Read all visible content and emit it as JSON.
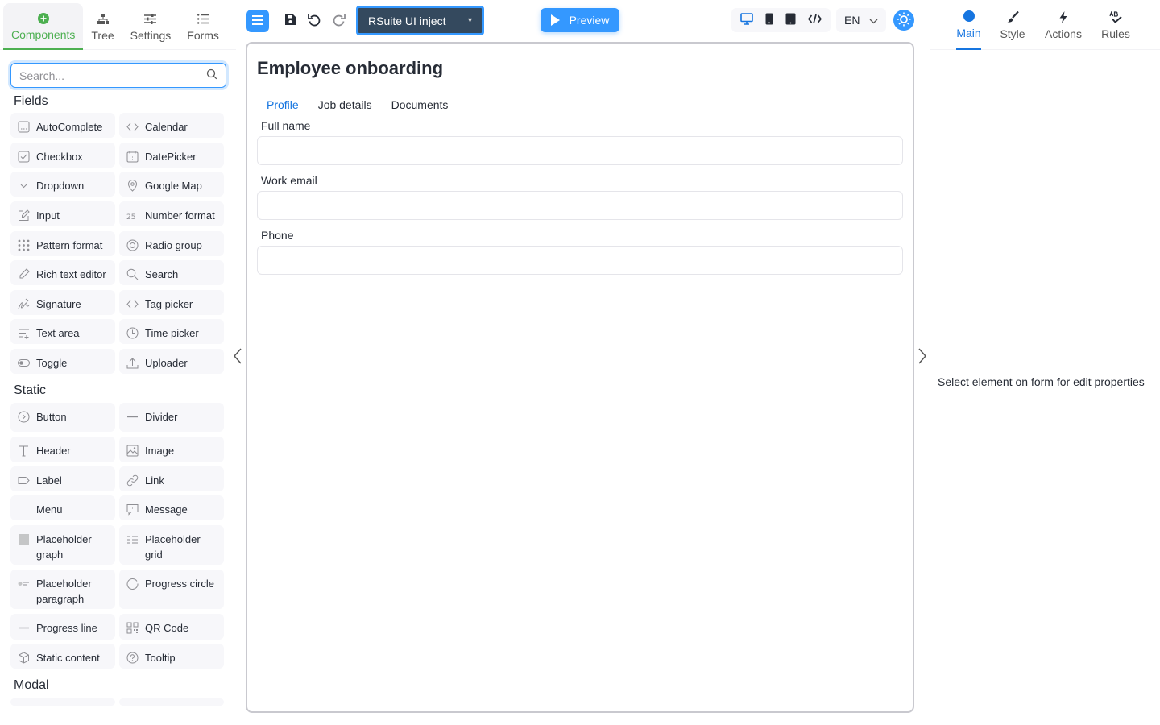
{
  "left_tabs": [
    {
      "label": "Components",
      "icon": "plus-circle-icon"
    },
    {
      "label": "Tree",
      "icon": "tree-icon"
    },
    {
      "label": "Settings",
      "icon": "sliders-icon"
    },
    {
      "label": "Forms",
      "icon": "list-icon"
    }
  ],
  "search": {
    "placeholder": "Search..."
  },
  "sections": {
    "fields": "Fields",
    "static": "Static",
    "modal": "Modal"
  },
  "fields": [
    "AutoComplete",
    "Calendar",
    "Checkbox",
    "DatePicker",
    "Dropdown",
    "Google Map",
    "Input",
    "Number format",
    "Pattern format",
    "Radio group",
    "Rich text editor",
    "Search",
    "Signature",
    "Tag picker",
    "Text area",
    "Time picker",
    "Toggle",
    "Uploader"
  ],
  "static_items": [
    "Button",
    "Divider",
    "Header",
    "Image",
    "Label",
    "Link",
    "Menu",
    "Message",
    "Placeholder graph",
    "Placeholder grid",
    "Placeholder paragraph",
    "Progress circle",
    "Progress line",
    "QR Code",
    "Static content",
    "Tooltip"
  ],
  "toolbar": {
    "form_name": "RSuite UI inject",
    "preview_label": "Preview",
    "language": "EN"
  },
  "form": {
    "title": "Employee onboarding",
    "tabs": [
      "Profile",
      "Job details",
      "Documents"
    ],
    "fields": [
      "Full name",
      "Work email",
      "Phone"
    ]
  },
  "right_tabs": [
    {
      "label": "Main",
      "icon": "dot-icon"
    },
    {
      "label": "Style",
      "icon": "brush-icon"
    },
    {
      "label": "Actions",
      "icon": "bolt-icon"
    },
    {
      "label": "Rules",
      "icon": "rules-icon"
    }
  ],
  "properties_hint": "Select element on form for edit properties",
  "colors": {
    "accent": "#3498ff",
    "active_green": "#4caf50",
    "active_blue": "#1675e0"
  }
}
